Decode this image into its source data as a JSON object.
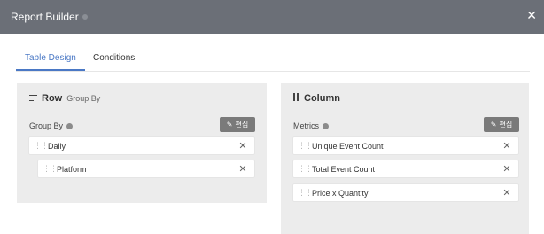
{
  "window": {
    "title": "Report Builder",
    "close_glyph": "✕"
  },
  "tabs": [
    {
      "label": "Table Design",
      "active": true
    },
    {
      "label": "Conditions",
      "active": false
    }
  ],
  "row_panel": {
    "title": "Row",
    "subtitle": "Group By",
    "section_label": "Group By",
    "edit_label": "편집",
    "items": [
      {
        "label": "Daily"
      },
      {
        "label": "Platform"
      }
    ]
  },
  "column_panel": {
    "title": "Column",
    "section_label": "Metrics",
    "edit_label": "편집",
    "items": [
      {
        "label": "Unique Event Count"
      },
      {
        "label": "Total Event Count"
      },
      {
        "label": "Price x Quantity"
      }
    ]
  },
  "icons": {
    "row": "lines-icon",
    "column": "columns-icon",
    "info": "info-icon",
    "drag": "drag-handle-icon",
    "remove": "close-icon",
    "edit": "pencil-icon"
  },
  "colors": {
    "header_bg": "#6b6f77",
    "accent": "#4a78c5",
    "panel_bg": "#ececec",
    "edit_button_bg": "#7a7a7a"
  }
}
